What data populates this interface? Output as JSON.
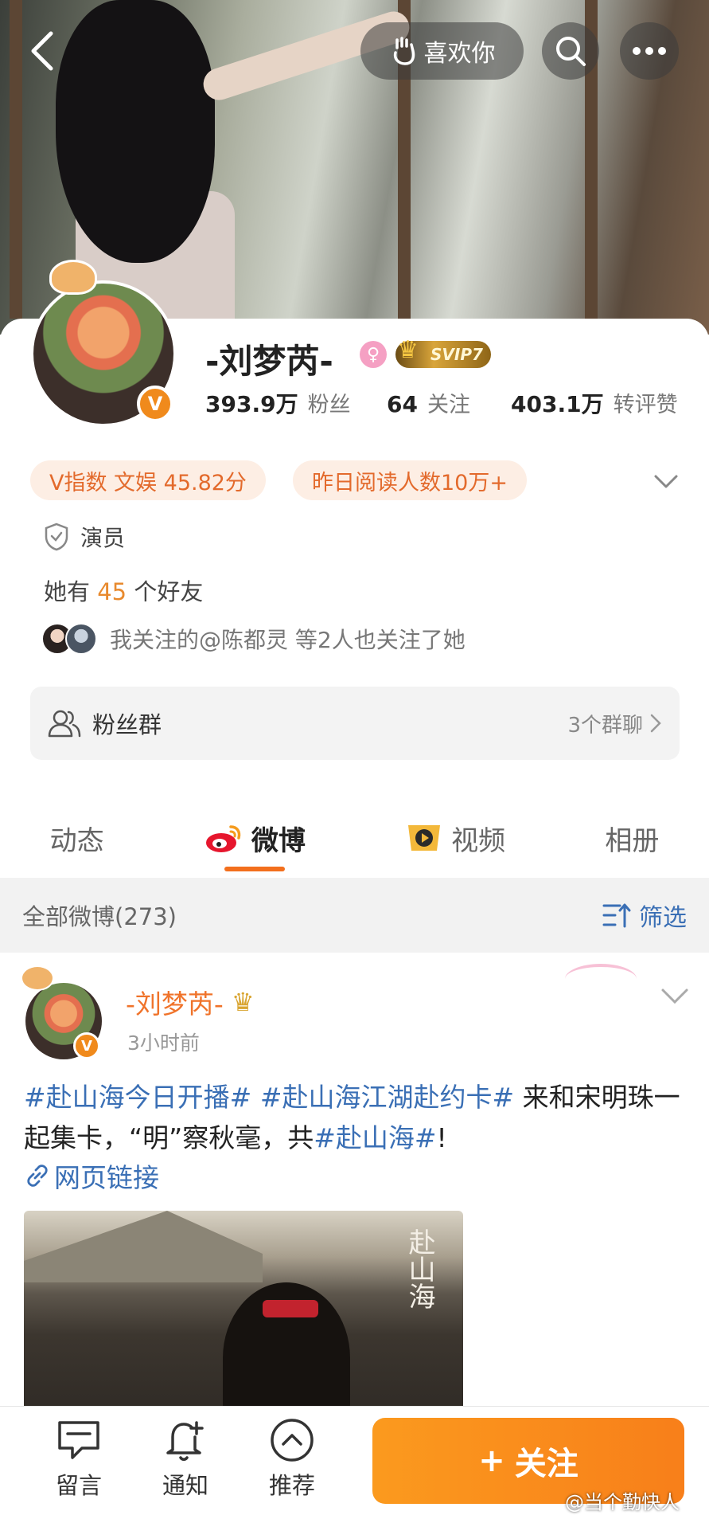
{
  "header": {
    "like_label": "喜欢你"
  },
  "profile": {
    "name": "-刘梦芮-",
    "svip": "SVIP7",
    "stats": [
      {
        "num": "393.9万",
        "label": "粉丝"
      },
      {
        "num": "64",
        "label": "关注"
      },
      {
        "num": "403.1万",
        "label": "转评赞"
      }
    ],
    "v_index": "V指数 文娱 45.82分",
    "reads": "昨日阅读人数10万+",
    "role": "演员",
    "friends_prefix": "她有",
    "friends_count": "45",
    "friends_suffix": "个好友",
    "mutual_text": "我关注的@陈都灵 等2人也关注了她",
    "fan_group_label": "粉丝群",
    "fan_group_count": "3个群聊"
  },
  "tabs": [
    "动态",
    "微博",
    "视频",
    "相册"
  ],
  "filter": {
    "all_label": "全部微博(273)",
    "filter_label": "筛选"
  },
  "post": {
    "author": "-刘梦芮-",
    "time": "3小时前",
    "tag1": "#赴山海今日开播#",
    "tag2": "#赴山海江湖赴约卡#",
    "text1": " 来和宋明珠一起集卡，“明”察秋毫，共",
    "tag3": "#赴山海#",
    "text2": "!",
    "link_label": "网页链接",
    "image_caption": "赴山海"
  },
  "bottom": {
    "message": "留言",
    "notify": "通知",
    "recommend": "推荐",
    "follow": "关注",
    "follow_plus": "+"
  },
  "watermark": "@当个勤快人",
  "colors": {
    "accent": "#f36f1d",
    "link": "#3a6fb5",
    "follow_button": "#fa8d1c"
  }
}
